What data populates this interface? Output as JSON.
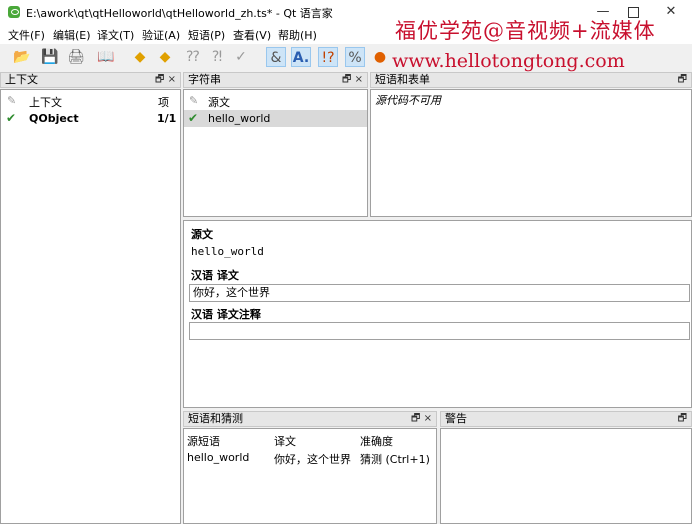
{
  "window": {
    "title": "E:\\awork\\qt\\qtHelloworld\\qtHelloworld_zh.ts* - Qt 语言家",
    "minimize": "—",
    "close": "✕"
  },
  "watermark": {
    "line1": "福优学苑@音视频+流媒体",
    "line2": "www.hellotongtong.com"
  },
  "menu": [
    "文件(F)",
    "编辑(E)",
    "译文(T)",
    "验证(A)",
    "短语(P)",
    "查看(V)",
    "帮助(H)"
  ],
  "toolbar": {
    "icons": [
      "open-icon",
      "save-icon",
      "print-icon",
      "phrasebook-icon",
      "prev-icon",
      "next-icon",
      "prev-unfinished-icon",
      "next-unfinished-icon",
      "done-next-icon",
      "accelerator-check-icon",
      "punctuation-check-icon",
      "phrase-check-icon",
      "placemarker-check-icon",
      "whats-this-icon"
    ]
  },
  "context_pane": {
    "title": "上下文",
    "columns": {
      "context": "上下文",
      "items": "项"
    },
    "rows": [
      {
        "name": "QObject",
        "count": "1/1"
      }
    ]
  },
  "strings_pane": {
    "title": "字符串",
    "columns": {
      "source": "源文"
    },
    "rows": [
      {
        "text": "hello_world"
      }
    ]
  },
  "phrases_pane": {
    "title": "短语和表单",
    "message": "源代码不可用"
  },
  "editor": {
    "source_label": "源文",
    "source_text": "hello_world",
    "translation_label": "汉语 译文",
    "translation_value": "你好，这个世界",
    "comment_label": "汉语 译文注释",
    "comment_value": ""
  },
  "guesses_pane": {
    "title": "短语和猜测",
    "columns": {
      "source": "源短语",
      "translation": "译文",
      "confidence": "准确度"
    },
    "rows": [
      {
        "source": "hello_world",
        "translation": "你好，这个世界",
        "confidence": "猜测 (Ctrl+1)"
      }
    ]
  },
  "warnings_pane": {
    "title": "警告"
  },
  "pane_controls": {
    "float": "🗗",
    "close": "×"
  }
}
